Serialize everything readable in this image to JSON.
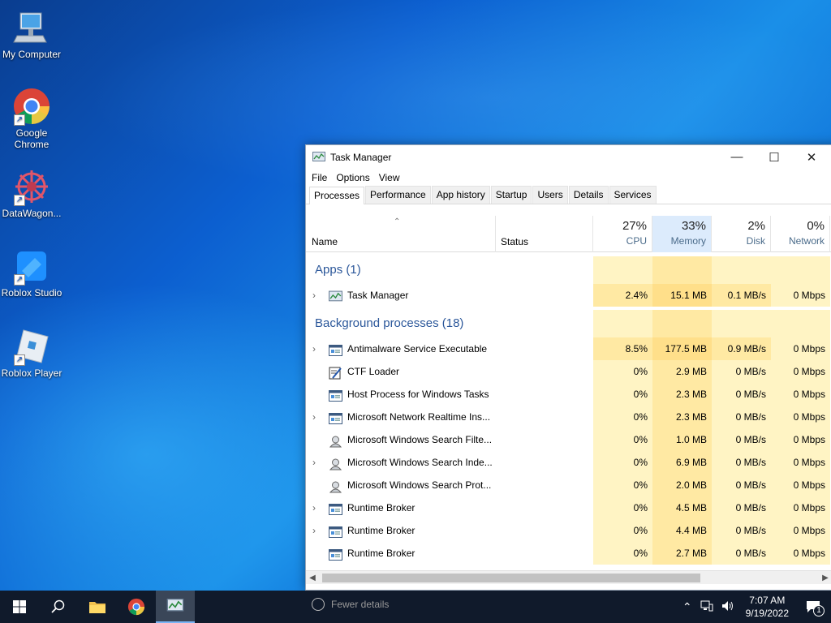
{
  "desktop": {
    "icons": [
      {
        "label": "My Computer",
        "icon": "computer-icon"
      },
      {
        "label": "Google Chrome",
        "icon": "chrome-icon"
      },
      {
        "label": "DataWagon...",
        "icon": "datawagon-icon"
      },
      {
        "label": "Roblox Studio",
        "icon": "roblox-studio-icon"
      },
      {
        "label": "Roblox Player",
        "icon": "roblox-player-icon"
      }
    ]
  },
  "window": {
    "title": "Task Manager",
    "menu": [
      "File",
      "Options",
      "View"
    ],
    "tabs": [
      "Processes",
      "Performance",
      "App history",
      "Startup",
      "Users",
      "Details",
      "Services"
    ],
    "active_tab": "Processes",
    "columns": {
      "name": "Name",
      "status": "Status",
      "cpu": {
        "pct": "27%",
        "label": "CPU"
      },
      "memory": {
        "pct": "33%",
        "label": "Memory"
      },
      "disk": {
        "pct": "2%",
        "label": "Disk"
      },
      "network": {
        "pct": "0%",
        "label": "Network"
      }
    },
    "groups": {
      "apps": "Apps (1)",
      "background": "Background processes (18)"
    },
    "apps": [
      {
        "name": "Task Manager",
        "cpu": "2.4%",
        "mem": "15.1 MB",
        "disk": "0.1 MB/s",
        "net": "0 Mbps",
        "expandable": true,
        "icon": "task-manager-icon"
      }
    ],
    "background": [
      {
        "name": "Antimalware Service Executable",
        "cpu": "8.5%",
        "mem": "177.5 MB",
        "disk": "0.9 MB/s",
        "net": "0 Mbps",
        "expandable": true,
        "icon": "service-icon"
      },
      {
        "name": "CTF Loader",
        "cpu": "0%",
        "mem": "2.9 MB",
        "disk": "0 MB/s",
        "net": "0 Mbps",
        "expandable": false,
        "icon": "ctf-icon"
      },
      {
        "name": "Host Process for Windows Tasks",
        "cpu": "0%",
        "mem": "2.3 MB",
        "disk": "0 MB/s",
        "net": "0 Mbps",
        "expandable": false,
        "icon": "service-icon"
      },
      {
        "name": "Microsoft Network Realtime Ins...",
        "cpu": "0%",
        "mem": "2.3 MB",
        "disk": "0 MB/s",
        "net": "0 Mbps",
        "expandable": true,
        "icon": "service-icon"
      },
      {
        "name": "Microsoft Windows Search Filte...",
        "cpu": "0%",
        "mem": "1.0 MB",
        "disk": "0 MB/s",
        "net": "0 Mbps",
        "expandable": false,
        "icon": "search-indexer-icon"
      },
      {
        "name": "Microsoft Windows Search Inde...",
        "cpu": "0%",
        "mem": "6.9 MB",
        "disk": "0 MB/s",
        "net": "0 Mbps",
        "expandable": true,
        "icon": "search-indexer-icon"
      },
      {
        "name": "Microsoft Windows Search Prot...",
        "cpu": "0%",
        "mem": "2.0 MB",
        "disk": "0 MB/s",
        "net": "0 Mbps",
        "expandable": false,
        "icon": "search-indexer-icon"
      },
      {
        "name": "Runtime Broker",
        "cpu": "0%",
        "mem": "4.5 MB",
        "disk": "0 MB/s",
        "net": "0 Mbps",
        "expandable": true,
        "icon": "service-icon"
      },
      {
        "name": "Runtime Broker",
        "cpu": "0%",
        "mem": "4.4 MB",
        "disk": "0 MB/s",
        "net": "0 Mbps",
        "expandable": true,
        "icon": "service-icon"
      },
      {
        "name": "Runtime Broker",
        "cpu": "0%",
        "mem": "2.7 MB",
        "disk": "0 MB/s",
        "net": "0 Mbps",
        "expandable": false,
        "icon": "service-icon"
      }
    ],
    "fewer_details": "Fewer details"
  },
  "taskbar": {
    "time": "7:07 AM",
    "date": "9/19/2022",
    "notification_count": "1"
  },
  "colors": {
    "heat_low": "#fff4c4",
    "heat_mid": "#ffe9a3",
    "mem_header": "#dcebfc",
    "group_text": "#2b579a"
  }
}
